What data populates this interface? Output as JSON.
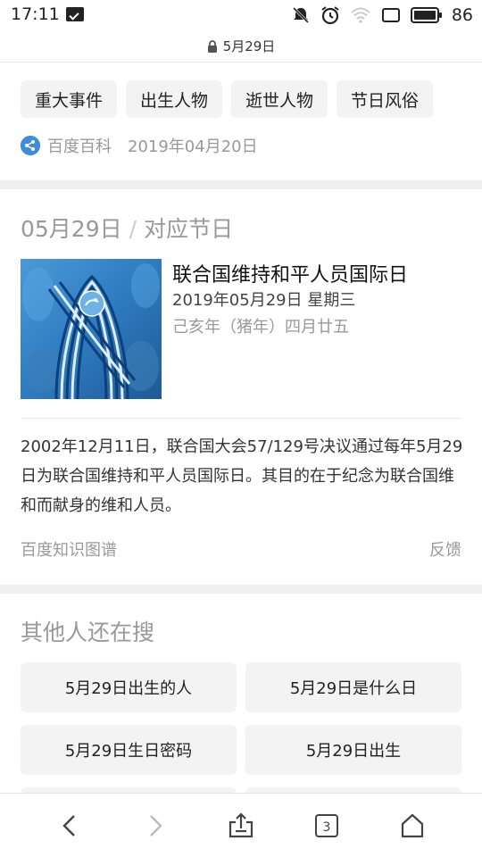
{
  "status_bar": {
    "time": "17:11",
    "battery_level": "86",
    "icons": [
      "message-icon",
      "mute-icon",
      "alarm-icon",
      "wifi-icon",
      "screen-icon",
      "battery-icon"
    ]
  },
  "url_bar": {
    "title": "5月29日",
    "lock_icon": "lock-icon"
  },
  "categories": {
    "items": [
      "重大事件",
      "出生人物",
      "逝世人物",
      "节日风俗"
    ]
  },
  "source": {
    "name": "百度百科",
    "date": "2019年04月20日"
  },
  "festival_section": {
    "date_label": "05月29日",
    "separator": "/",
    "section_label": "对应节日",
    "title": "联合国维持和平人员国际日",
    "gregorian": "2019年05月29日 星期三",
    "lunar": "己亥年（猪年）四月廿五",
    "description": "2002年12月11日，联合国大会57/129号决议通过每年5月29日为联合国维持和平人员国际日。其目的在于纪念为联合国维和而献身的维和人员。",
    "kg_source": "百度知识图谱",
    "feedback": "反馈"
  },
  "related_searches": {
    "title": "其他人还在搜",
    "items": [
      "5月29日出生的人",
      "5月29日是什么日",
      "5月29日生日密码",
      "5月29日出生"
    ]
  },
  "bottom_nav": {
    "tab_count": "3",
    "colors": {
      "active": "#444444",
      "disabled": "#bbbbbb"
    }
  },
  "colors": {
    "divider": "#f0f0f0",
    "chip_bg": "#f3f3f3",
    "muted_text": "#999999",
    "baike_blue": "#3f8bdd",
    "poster_blue": "#2b74b8"
  }
}
